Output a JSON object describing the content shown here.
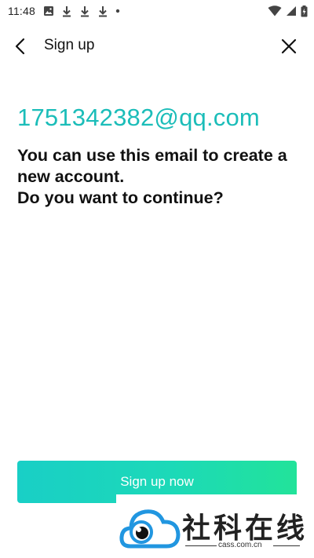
{
  "status_bar": {
    "time": "11:48",
    "left_icons": [
      "image-icon",
      "download-icon",
      "download-icon",
      "download-icon",
      "dot-icon"
    ],
    "right_icons": [
      "wifi-icon",
      "signal-icon",
      "battery-icon"
    ]
  },
  "header": {
    "title": "Sign up",
    "back_icon": "chevron-left-icon",
    "close_icon": "close-icon"
  },
  "content": {
    "email": "1751342382@qq.com",
    "message_lines": [
      "You can use this email to create a",
      "new account.",
      "Do you want to continue?"
    ]
  },
  "actions": {
    "signup_label": "Sign up now"
  },
  "watermark": {
    "title": "社科在线",
    "subtitle": "cass.com.cn"
  },
  "colors": {
    "accent": "#1bbdb9",
    "button_start": "#19cfc6",
    "button_end": "#22e39a",
    "logo_blue": "#2196e0"
  }
}
